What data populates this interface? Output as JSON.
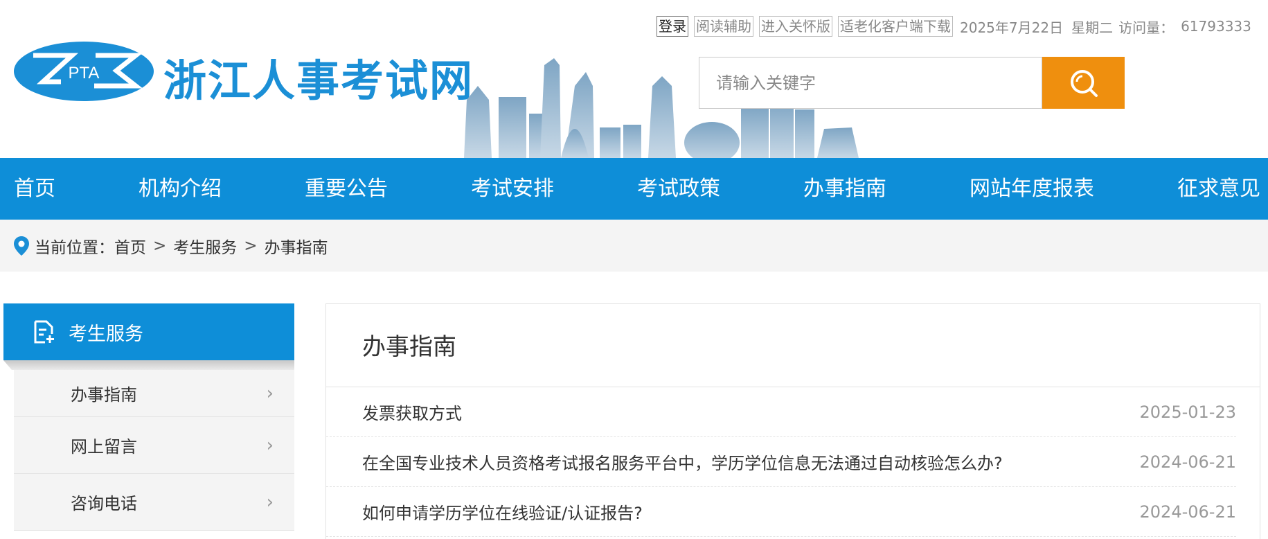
{
  "header": {
    "site_title": "浙江人事考试网",
    "logo_text": "PTA",
    "toplinks": [
      "登录",
      "阅读辅助",
      "进入关怀版",
      "适老化客户端下载"
    ],
    "date": "2025年7月22日",
    "weekday": "星期二",
    "visits_label": "访问量：",
    "visits_value": "61793333",
    "search_placeholder": "请输入关键字"
  },
  "nav": [
    "首页",
    "机构介绍",
    "重要公告",
    "考试安排",
    "考试政策",
    "办事指南",
    "网站年度报表",
    "征求意见"
  ],
  "breadcrumb": {
    "label": "当前位置：",
    "items": [
      "首页",
      "考生服务",
      "办事指南"
    ],
    "separator": ">"
  },
  "sidebar": {
    "title": "考生服务",
    "items": [
      "办事指南",
      "网上留言",
      "咨询电话"
    ]
  },
  "main": {
    "title": "办事指南",
    "rows": [
      {
        "title": "发票获取方式",
        "date": "2025-01-23"
      },
      {
        "title": "在全国专业技术人员资格考试报名服务平台中，学历学位信息无法通过自动核验怎么办?",
        "date": "2024-06-21"
      },
      {
        "title": "如何申请学历学位在线验证/认证报告?",
        "date": "2024-06-21"
      }
    ]
  },
  "colors": {
    "brand_blue": "#0e8ed8",
    "search_orange": "#ef8f0e",
    "title_blue": "#1b8fd6"
  },
  "icons": [
    "search-icon",
    "location-pin-icon",
    "document-icon",
    "chevron-right-icon"
  ]
}
